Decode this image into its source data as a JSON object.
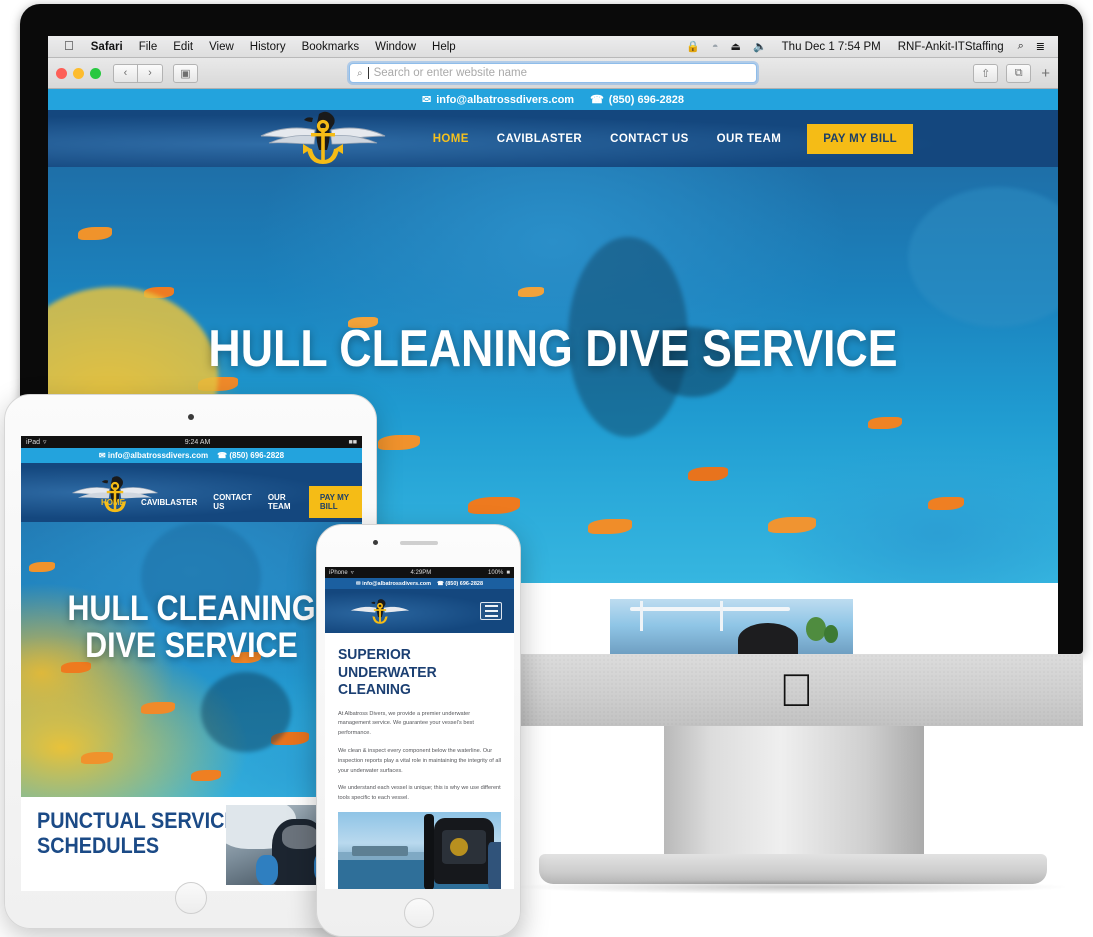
{
  "os": {
    "menu_items": [
      "Safari",
      "File",
      "Edit",
      "View",
      "History",
      "Bookmarks",
      "Window",
      "Help"
    ],
    "apple_glyph": "",
    "status_icons": [
      "lock-icon",
      "wifi-icon",
      "eject-icon",
      "volume-icon"
    ],
    "clock": "Thu Dec 1  7:54 PM",
    "user": "RNF-Ankit-ITStaffing",
    "search_icon": "search-icon",
    "list_icon": "list-icon"
  },
  "browser": {
    "back_label": "‹",
    "forward_label": "›",
    "sidebar_label": "▣",
    "url_placeholder": "Search or enter website name",
    "url_value": "",
    "search_glyph": "⌕",
    "share_label": "⇧",
    "tabs_label": "⧉",
    "new_tab_label": "+"
  },
  "site": {
    "topbar": {
      "email": "info@albatrossdivers.com",
      "phone": "(850) 696-2828",
      "email_icon": "envelope-icon",
      "phone_icon": "phone-icon"
    },
    "logo_name": "albatross-anchor-logo",
    "nav": [
      {
        "label": "HOME",
        "active": true
      },
      {
        "label": "CAVIBLASTER",
        "active": false
      },
      {
        "label": "CONTACT US",
        "active": false
      },
      {
        "label": "OUR TEAM",
        "active": false
      }
    ],
    "cta": "PAY MY BILL",
    "hero_title": "HULL CLEANING DIVE SERVICE",
    "colors": {
      "accent_yellow": "#f5bc16",
      "navy": "#14477e",
      "sky_blue": "#23a3dd",
      "deep_blue": "#1b4a86"
    }
  },
  "tablet": {
    "device": "iPad",
    "status_time": "9:24 AM",
    "battery": "",
    "hero_title_line1": "HULL CLEANING",
    "hero_title_line2": "DIVE SERVICE",
    "section_title": "PUNCTUAL SERVICE SCHEDULES",
    "photo_name": "diver-thumbs-up-photo"
  },
  "phone": {
    "device": "iPhone",
    "status_time": "4:29PM",
    "battery": "100%",
    "menu_icon": "hamburger-menu-icon",
    "heading": "SUPERIOR UNDERWATER CLEANING",
    "paragraphs": [
      "At Albatross Divers, we provide a premier underwater management service. We guarantee your vessel's best performance.",
      "We clean & inspect every component below the waterline. Our inspection reports play a vital role in maintaining the integrity of all your underwater surfaces.",
      "We understand each vessel is unique; this is why we use different tools specific to each vessel."
    ],
    "photo_name": "dive-gear-on-boat-photo"
  },
  "desktop_below": {
    "photo_name": "boat-on-water-photo"
  }
}
